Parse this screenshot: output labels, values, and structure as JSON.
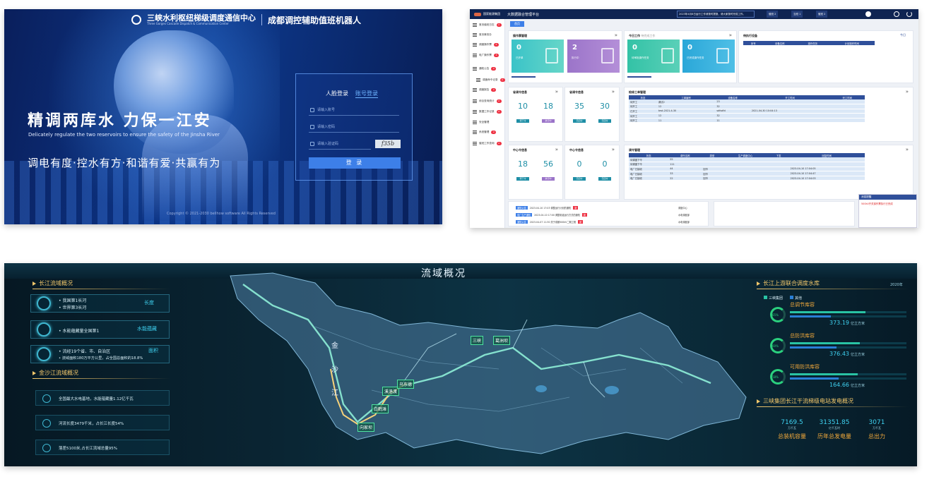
{
  "login": {
    "org_name": "三峡水利枢纽梯级调度通信中心",
    "org_en": "Three Gorges Cascade Dispatch & Communication Center",
    "system_title": "成都调控辅助值班机器人",
    "slogan": "精调两库水  力保一江安",
    "slogan_en": "Delicately regulate the two reservoirs to ensure the safety of the Jinsha River",
    "slogan2": "调电有度·控水有方·和谐有爱·共赢有为",
    "tab_face": "人脸登录",
    "tab_account": "账号登录",
    "username_placeholder": "请输入账号",
    "password_placeholder": "请输入密码",
    "captcha_placeholder": "请输入验证码",
    "captcha_value": "f35b",
    "login_button": "登 录",
    "copyright": "Copyright © 2021-2030 bellhow software All Rights Reserved"
  },
  "admin": {
    "platform_title": "大数据融合管理平台",
    "brand": "国家能源集团",
    "marquee": "2023年4月8日运行工作请按时提报，请大家按时完成工作。",
    "top_stats": [
      "值班 2",
      "当班 1",
      "值班 2"
    ],
    "breadcrumb": "首页",
    "sidebar": [
      {
        "label": "首页值班日志",
        "badge": "2"
      },
      {
        "label": "首页事务办",
        "badge": ""
      },
      {
        "label": "调度操作票",
        "badge": "5"
      },
      {
        "label": "电厂操作票",
        "badge": "3"
      },
      {
        "label": "通知公告",
        "badge": "2"
      },
      {
        "label": "调度命令记录",
        "badge": "2"
      },
      {
        "label": "调度报告",
        "badge": "2"
      },
      {
        "label": "综合查询统计",
        "badge": "2"
      },
      {
        "label": "数据工作记录",
        "badge": "2"
      },
      {
        "label": "安全管理",
        "badge": ""
      },
      {
        "label": "系统管理",
        "badge": "2"
      },
      {
        "label": "值班工作查询",
        "badge": "2"
      }
    ],
    "ops_card": {
      "title": "操作票管理",
      "tiles": [
        {
          "value": "0",
          "label": "已开单"
        },
        {
          "value": "2",
          "label": "执行中"
        }
      ]
    },
    "today_card": {
      "title": "今日工作",
      "subtitle": "待完成工作",
      "tiles": [
        {
          "value": "0",
          "label": "待审批操作任务"
        },
        {
          "value": "0",
          "label": "已完成操作任务"
        }
      ]
    },
    "plan_card": {
      "title": "待执行设备",
      "tag": "今日",
      "columns": [
        "序号",
        "设备名称",
        "操作任务",
        "计划操作时间"
      ]
    },
    "stat_cards": [
      {
        "title": "省调令信息",
        "a": "10",
        "b": "18",
        "la": "待下令",
        "lb": "执行中"
      },
      {
        "title": "省调令信息",
        "a": "35",
        "b": "30",
        "la": "已回令",
        "lb": "已回令"
      },
      {
        "title": "中心令信息",
        "a": "18",
        "b": "56",
        "la": "待下令",
        "lb": "执行中"
      },
      {
        "title": "中心令信息",
        "a": "0",
        "b": "0",
        "la": "已回令",
        "lb": "已回令"
      }
    ],
    "work_table": {
      "title": "检修工单管理",
      "columns": [
        "状态",
        "工单编号",
        "设备名称",
        "开工时间",
        "完工时间"
      ],
      "rows": [
        [
          "待开工",
          "调试2",
          "23",
          "",
          ""
        ],
        [
          "待开工",
          "12",
          "32",
          "",
          ""
        ],
        [
          "已开工",
          "test-2021-4-30",
          "sdfsdfd",
          "2021-04-30 10:04:13",
          ""
        ],
        [
          "待开工",
          "12",
          "32",
          "",
          ""
        ],
        [
          "待开工",
          "11",
          "11",
          "",
          ""
        ]
      ]
    },
    "order_table": {
      "title": "调令管理",
      "columns": [
        "状态",
        "调令名称",
        "类型",
        "生产调度中心",
        "下发",
        "回复时间"
      ],
      "rows": [
        [
          "待调度下令",
          "55",
          "",
          "",
          "",
          ""
        ],
        [
          "待调度下令",
          "111",
          "",
          "",
          "",
          ""
        ],
        [
          "电厂已接收",
          "44",
          "回令",
          "",
          "",
          "2023-04-10 17:04:05"
        ],
        [
          "电厂已接收",
          "33",
          "回令",
          "",
          "",
          "2023-04-10 17:04:47"
        ],
        [
          "电厂已接收",
          "22",
          "回令",
          "",
          "",
          "2023-04-10 17:04:03"
        ]
      ]
    },
    "notices": [
      {
        "tag": "通知公告",
        "time": "2023-04-10 17:03",
        "text": "调整运行计划的通知",
        "flag": "新",
        "dept": "调度中心"
      },
      {
        "tag": "电厂生产通知",
        "time": "2023-04-10 17:00",
        "text": "调整机组运行方式的通知",
        "flag": "新",
        "dept": "水电调度部"
      },
      {
        "tag": "通知公告",
        "time": "2023-04-07 11:30",
        "text": "关于成都500kV二期工程",
        "flag": "新",
        "dept": "水电调度部"
      }
    ],
    "popup": {
      "title": "消息提醒",
      "text": "500kV开关操作票执行已完成"
    }
  },
  "dash": {
    "title": "流域概况",
    "left_section_1": "长江流域概况",
    "cj_items": [
      {
        "lines": [
          "我国第1长河",
          "世界第3长河"
        ],
        "tag": "长度"
      },
      {
        "lines": [
          "水能蕴藏量全国第1"
        ],
        "tag": "水能蕴藏"
      },
      {
        "lines": [
          "流经19个省、市、自治区",
          "流域面积180万平方公里，占全国总面积的18.8%"
        ],
        "tag": "面积"
      }
    ],
    "left_section_2": "金沙江流域概况",
    "jsj_items": [
      "全国最大水电基地，水能蕴藏量1.12亿千瓦",
      "河流长度3479千米，占长江长度54%",
      "落差5100米,占长江流域总量95%"
    ],
    "right_section_1": "长江上游联合调度水库",
    "right_year": "2020年",
    "legend": [
      "三峡集团",
      "其他"
    ],
    "reservoirs": [
      {
        "name": "总调节库容",
        "pct": "65%",
        "value": "373.19",
        "unit": "亿立方米",
        "fill": 0.65
      },
      {
        "name": "总防洪库容",
        "pct": "60%",
        "value": "376.43",
        "unit": "亿立方米",
        "fill": 0.6
      },
      {
        "name": "可用防洪库容",
        "pct": "58%",
        "value": "164.66",
        "unit": "亿立方米",
        "fill": 0.58
      }
    ],
    "right_section_2": "三峡集团长江干流梯级电站发电概况",
    "gen": [
      {
        "value": "7169.5",
        "unit": "万千瓦",
        "label": "总装机容量"
      },
      {
        "value": "31351.85",
        "unit": "亿千瓦时",
        "label": "历年总发电量"
      },
      {
        "value": "3071",
        "unit": "万千瓦",
        "label": "总出力"
      }
    ],
    "map_labels": [
      "三峡",
      "葛洲坝",
      "白鹤滩",
      "溪洛渡",
      "乌东德",
      "向家坝"
    ],
    "river_name": [
      "金",
      "沙",
      "江"
    ]
  }
}
